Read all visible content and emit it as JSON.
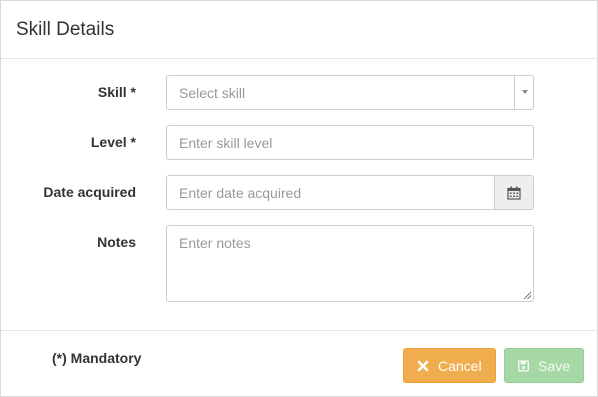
{
  "dialog": {
    "title": "Skill Details"
  },
  "form": {
    "skill": {
      "label": "Skill *",
      "placeholder": "Select skill"
    },
    "level": {
      "label": "Level *",
      "placeholder": "Enter skill level"
    },
    "date_acquired": {
      "label": "Date acquired",
      "placeholder": "Enter date acquired",
      "icon": "calendar-icon"
    },
    "notes": {
      "label": "Notes",
      "placeholder": "Enter notes"
    }
  },
  "footer": {
    "mandatory_note": "(*) Mandatory",
    "cancel_label": "Cancel",
    "cancel_icon": "times-icon",
    "save_label": "Save",
    "save_icon": "save-icon"
  },
  "colors": {
    "cancel": "#f0ad4e",
    "save_disabled": "#a6d8a6",
    "addon_bg": "#eeeeee"
  }
}
